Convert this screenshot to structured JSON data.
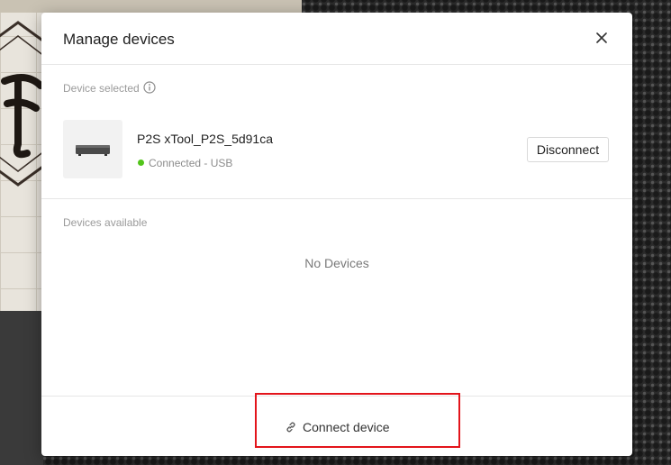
{
  "dialog": {
    "title": "Manage devices",
    "close_icon": "close-icon"
  },
  "selected": {
    "label": "Device selected",
    "info_icon": "info-icon",
    "device": {
      "name": "P2S xTool_P2S_5d91ca",
      "status": "Connected - USB",
      "status_color": "#52c41a"
    },
    "disconnect_label": "Disconnect"
  },
  "available": {
    "label": "Devices available",
    "empty_text": "No Devices"
  },
  "footer": {
    "connect_label": "Connect device",
    "connect_icon": "link-icon"
  },
  "colors": {
    "highlight": "#e3141b"
  }
}
